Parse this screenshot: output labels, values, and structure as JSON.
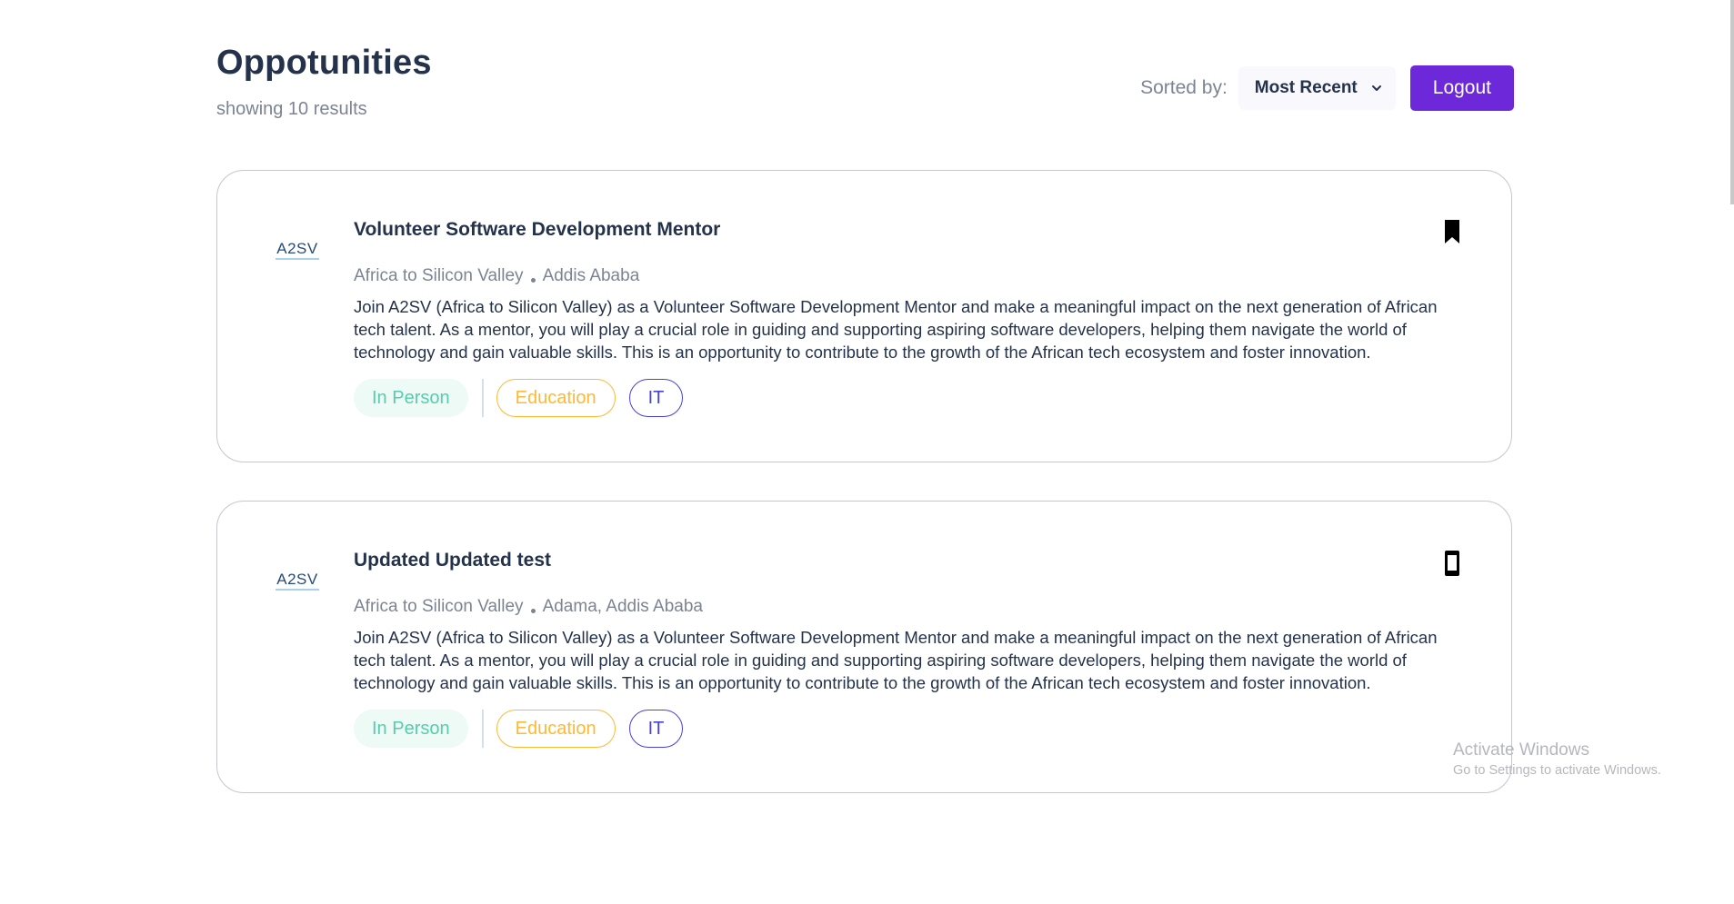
{
  "header": {
    "title": "Oppotunities",
    "results_text": "showing 10 results",
    "sort_label": "Sorted by:",
    "sort_value": "Most Recent",
    "logout_label": "Logout"
  },
  "colors": {
    "accent": "#6d28d9",
    "in_person": "#56cdad",
    "education": "#ffb836",
    "it": "#4640de"
  },
  "opportunities": [
    {
      "logo_text": "A2SV",
      "title": "Volunteer Software Development Mentor",
      "company": "Africa to Silicon Valley",
      "location": "Addis Ababa",
      "description": "Join A2SV (Africa to Silicon Valley) as a Volunteer Software Development Mentor and make a meaningful impact on the next generation of African tech talent. As a mentor, you will play a crucial role in guiding and supporting aspiring software developers, helping them navigate the world of technology and gain valuable skills. This is an opportunity to contribute to the growth of the African tech ecosystem and foster innovation.",
      "tags": [
        "In Person",
        "Education",
        "IT"
      ],
      "bookmark_icon": "bookmark-filled-icon"
    },
    {
      "logo_text": "A2SV",
      "title": "Updated Updated test",
      "company": "Africa to Silicon Valley",
      "location": "Adama, Addis Ababa",
      "description": "Join A2SV (Africa to Silicon Valley) as a Volunteer Software Development Mentor and make a meaningful impact on the next generation of African tech talent. As a mentor, you will play a crucial role in guiding and supporting aspiring software developers, helping them navigate the world of technology and gain valuable skills. This is an opportunity to contribute to the growth of the African tech ecosystem and foster innovation.",
      "tags": [
        "In Person",
        "Education",
        "IT"
      ],
      "bookmark_icon": "bookmark-outline-icon"
    }
  ],
  "watermark": {
    "title": "Activate Windows",
    "subtitle": "Go to Settings to activate Windows."
  }
}
